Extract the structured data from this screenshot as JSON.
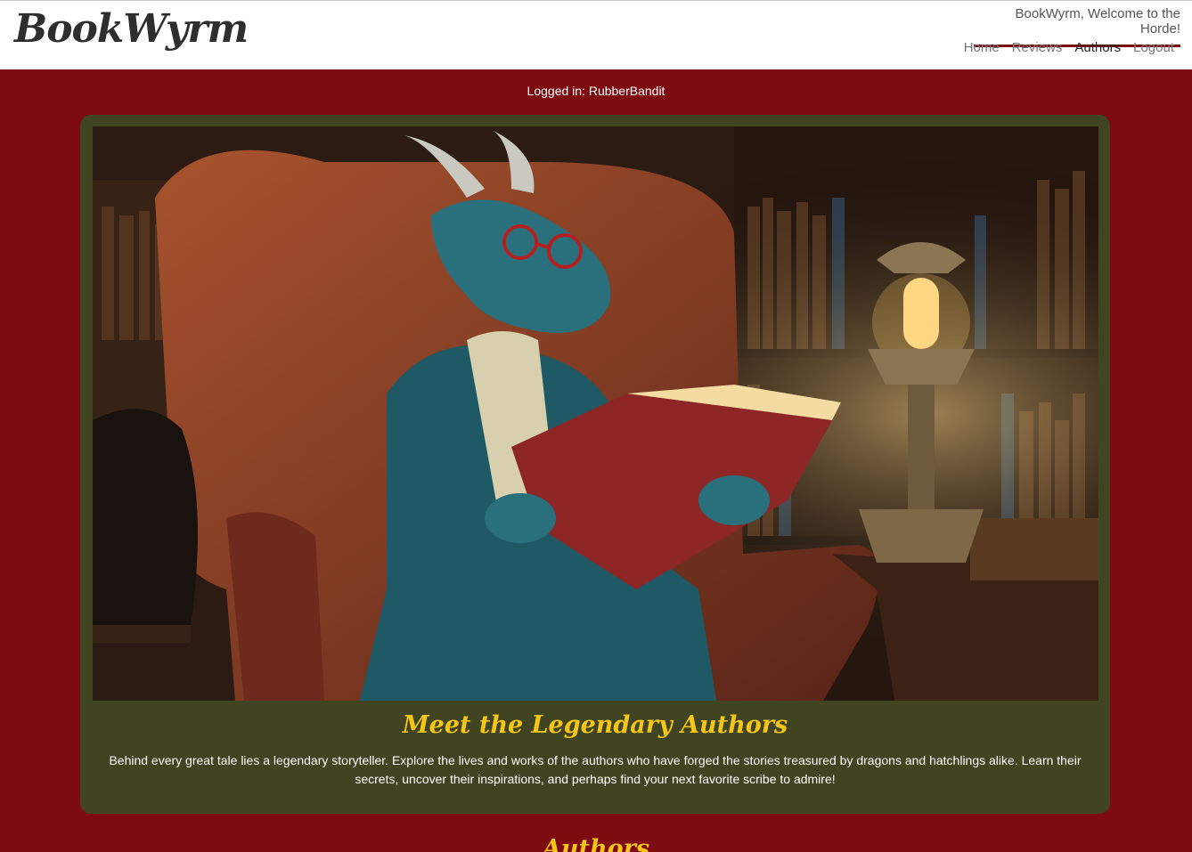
{
  "header": {
    "logo": "BookWyrm",
    "welcome": "BookWyrm, Welcome to the Horde!",
    "nav": [
      {
        "label": "Home"
      },
      {
        "label": "Reviews"
      },
      {
        "label": "Authors",
        "active": true
      },
      {
        "label": "Logout"
      }
    ]
  },
  "status": {
    "logged_in": "Logged in: RubberBandit"
  },
  "hero": {
    "image_alt": "Dragon reading a book in an armchair by lamplight",
    "title": "Meet the Legendary Authors",
    "text": "Behind every great tale lies a legendary storyteller. Explore the lives and works of the authors who have forged the stories treasured by dragons and hatchlings alike. Learn their secrets, uncover their inspirations, and perhaps find your next favorite scribe to admire!"
  },
  "section": {
    "title": "Authors"
  },
  "colors": {
    "primary": "#7d0b0f",
    "hero_bg": "#414420",
    "accent": "#f5c518"
  }
}
